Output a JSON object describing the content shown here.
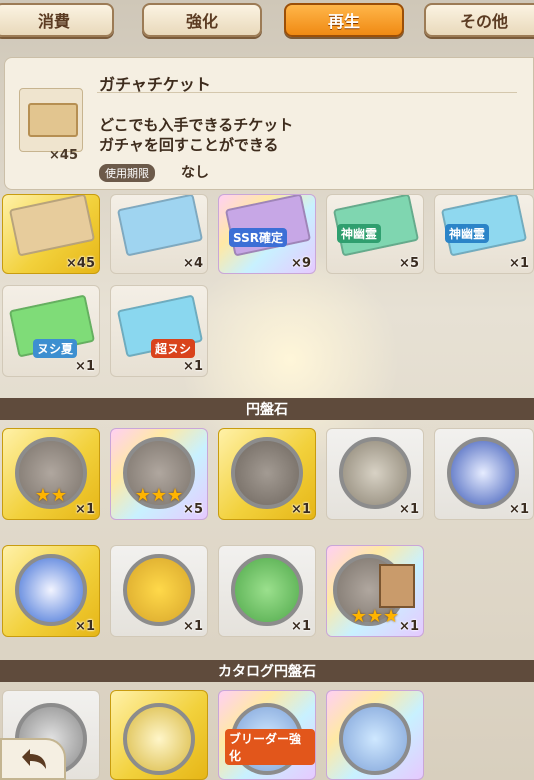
{
  "tabs": [
    {
      "label": "消費"
    },
    {
      "label": "強化"
    },
    {
      "label": "再生"
    },
    {
      "label": "その他"
    }
  ],
  "detail": {
    "title": "ガチャチケット",
    "desc1": "どこでも入手できるチケット",
    "desc2": "ガチャを回すことができる",
    "expiry_label": "使用期限",
    "expiry_value": "なし",
    "count": "×45"
  },
  "tickets_row1": [
    {
      "count": "×45",
      "style": "gold",
      "color": "#e7cc9c"
    },
    {
      "count": "×4",
      "style": "plain",
      "color": "#9fd4f0"
    },
    {
      "count": "×9",
      "style": "rainbow",
      "color": "#c7a7e6",
      "label": "SSR確定"
    },
    {
      "count": "×5",
      "style": "plain",
      "color": "#7fd6b0",
      "label": "神幽霊"
    },
    {
      "count": "×1",
      "style": "plain",
      "color": "#8fd8ef",
      "label": "神幽霊"
    }
  ],
  "tickets_row2": [
    {
      "count": "×1",
      "style": "plain",
      "color": "#7fdc78",
      "label": "ヌシ夏"
    },
    {
      "count": "×1",
      "style": "plain",
      "color": "#8ad7ef",
      "label": "超ヌシ"
    }
  ],
  "section1": "円盤石",
  "stones_row1": [
    {
      "count": "×1",
      "style": "gold",
      "stars": "★★",
      "coin": "#9a9088"
    },
    {
      "count": "×5",
      "style": "rainbow",
      "stars": "★★★",
      "coin": "#9a9088"
    },
    {
      "count": "×1",
      "style": "gold",
      "stars": "",
      "coin": "#8d857d"
    },
    {
      "count": "×1",
      "style": "blue",
      "stars": "",
      "coin": "#a49c88"
    },
    {
      "count": "×1",
      "style": "blue",
      "stars": "",
      "coin": "#3c5ab8"
    }
  ],
  "stones_row2": [
    {
      "count": "×1",
      "style": "gold",
      "stars": "",
      "coin": "#3d6ed6"
    },
    {
      "count": "×1",
      "style": "blue",
      "stars": "",
      "coin": "#d7a52a"
    },
    {
      "count": "×1",
      "style": "blue",
      "stars": "",
      "coin": "#4fa84a"
    },
    {
      "count": "×1",
      "style": "rainbow",
      "stars": "★★★",
      "coin": "#8f8780"
    }
  ],
  "section2": "カタログ円盤石",
  "catalog_row": [
    {
      "style": "blue",
      "label": ""
    },
    {
      "style": "gold",
      "label": ""
    },
    {
      "style": "rainbow",
      "label": "ブリーダー強化"
    },
    {
      "style": "rainbow",
      "label": ""
    }
  ]
}
